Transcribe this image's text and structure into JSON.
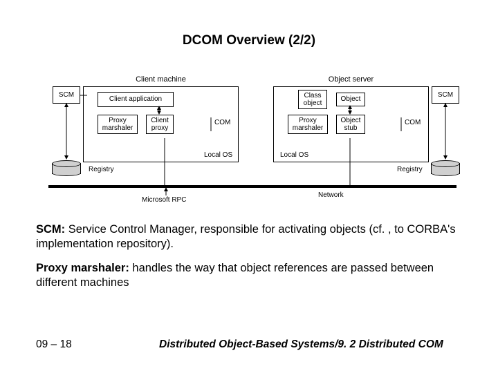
{
  "title": "DCOM Overview (2/2)",
  "diagram": {
    "client_machine_label": "Client machine",
    "server_machine_label": "Object server",
    "scm": "SCM",
    "client_app": "Client application",
    "class_object": "Class\nobject",
    "object": "Object",
    "proxy_marshaler": "Proxy\nmarshaler",
    "client_proxy": "Client\nproxy",
    "object_stub": "Object\nstub",
    "com": "COM",
    "local_os": "Local OS",
    "registry": "Registry",
    "network": "Network",
    "ms_rpc": "Microsoft RPC"
  },
  "para1_bold": "SCM:",
  "para1_rest": " Service Control Manager, responsible for activating objects (cf. , to CORBA's implementation repository).",
  "para2_bold": "Proxy marshaler:",
  "para2_rest": " handles the way that object references are passed between different machines",
  "footer_left": "09 – 18",
  "footer_right": "Distributed Object-Based Systems/9. 2 Distributed COM"
}
